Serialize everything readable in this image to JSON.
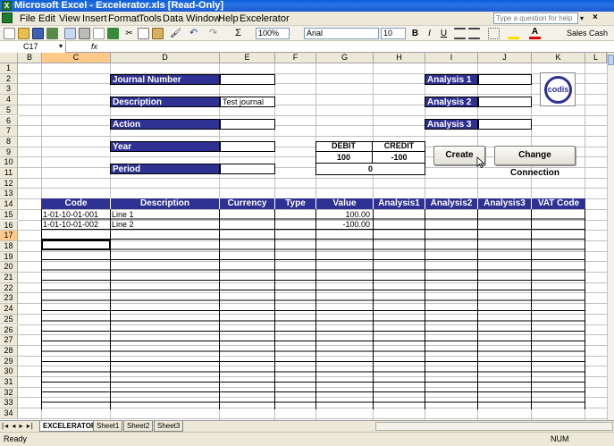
{
  "window": {
    "title": "Microsoft Excel - Excelerator.xls  [Read-Only]",
    "app_icon": "X"
  },
  "menu": [
    "File",
    "Edit",
    "View",
    "Insert",
    "Format",
    "Tools",
    "Data",
    "Window",
    "Help",
    "Excelerator"
  ],
  "ask_placeholder": "Type a question for help",
  "toolbar": {
    "zoom": "100%",
    "font": "Arial",
    "size": "10",
    "bold": "B",
    "italic": "I",
    "underline": "U",
    "sigma": "Σ",
    "sales_cash": "Sales Cash"
  },
  "formula": {
    "name_box": "C17",
    "fx": "fx",
    "content": ""
  },
  "columns": [
    "B",
    "C",
    "D",
    "E",
    "F",
    "G",
    "H",
    "I",
    "J",
    "K",
    "L"
  ],
  "rows": [
    "1",
    "2",
    "3",
    "4",
    "5",
    "6",
    "7",
    "8",
    "9",
    "10",
    "11",
    "12",
    "13",
    "14",
    "15",
    "16",
    "17",
    "18",
    "19",
    "20",
    "21",
    "22",
    "23",
    "24",
    "25",
    "26",
    "27",
    "28",
    "29",
    "30",
    "31",
    "32",
    "33",
    "34"
  ],
  "form": {
    "journal_number": "Journal Number",
    "description": "Description",
    "description_value": "Test journal",
    "action": "Action",
    "year": "Year",
    "period": "Period",
    "analysis1": "Analysis 1",
    "analysis2": "Analysis 2",
    "analysis3": "Analysis 3",
    "debit_label": "DEBIT",
    "credit_label": "CREDIT",
    "debit_value": "100",
    "credit_value": "-100",
    "balance": "0",
    "logo_text": "codis"
  },
  "buttons": {
    "create": "Create",
    "change_connection": "Change Connection"
  },
  "table": {
    "headers": [
      "Code",
      "Description",
      "Currency",
      "Type",
      "Value",
      "Analysis1",
      "Analysis2",
      "Analysis3",
      "VAT Code"
    ],
    "rows": [
      {
        "code": "1-01-10-01-001",
        "description": "Line 1",
        "value": "100.00"
      },
      {
        "code": "1-01-10-01-002",
        "description": "Line 2",
        "value": "-100.00"
      }
    ]
  },
  "sheets": [
    "EXCELERATOR",
    "Sheet1",
    "Sheet2",
    "Sheet3"
  ],
  "status": {
    "left": "Ready",
    "right": "NUM"
  },
  "colors": {
    "header_blue": "#2e3192",
    "title_blue": "#0a5fd8"
  }
}
